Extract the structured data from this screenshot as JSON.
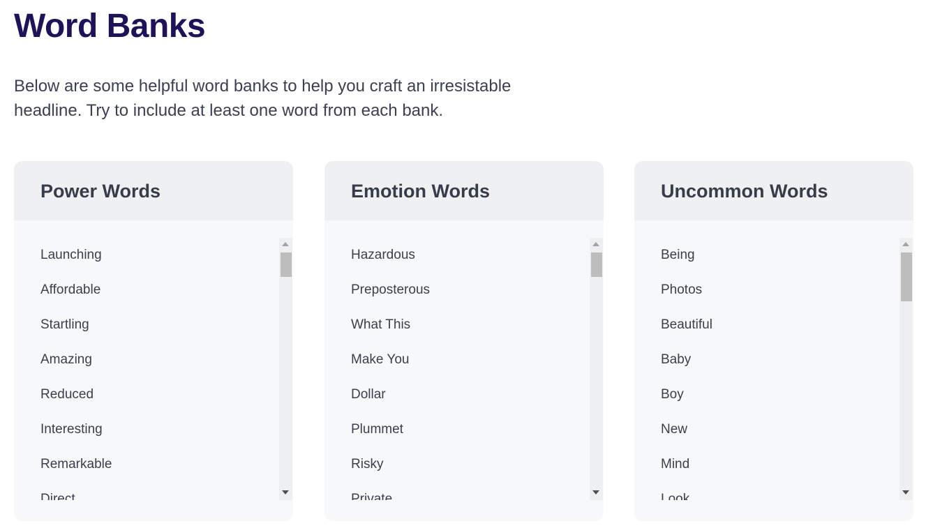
{
  "page": {
    "title": "Word Banks",
    "intro": "Below are some helpful word banks to help you craft an irresistable headline. Try to include at least one word from each bank."
  },
  "banks": [
    {
      "title": "Power Words",
      "words": [
        "Launching",
        "Affordable",
        "Startling",
        "Amazing",
        "Reduced",
        "Interesting",
        "Remarkable",
        "Direct"
      ],
      "scroll_thumb_fraction": 0.06
    },
    {
      "title": "Emotion Words",
      "words": [
        "Hazardous",
        "Preposterous",
        "What This",
        "Make You",
        "Dollar",
        "Plummet",
        "Risky",
        "Private"
      ],
      "scroll_thumb_fraction": 0.06
    },
    {
      "title": "Uncommon Words",
      "words": [
        "Being",
        "Photos",
        "Beautiful",
        "Baby",
        "Boy",
        "New",
        "Mind",
        "Look"
      ],
      "scroll_thumb_fraction": 0.12
    }
  ]
}
